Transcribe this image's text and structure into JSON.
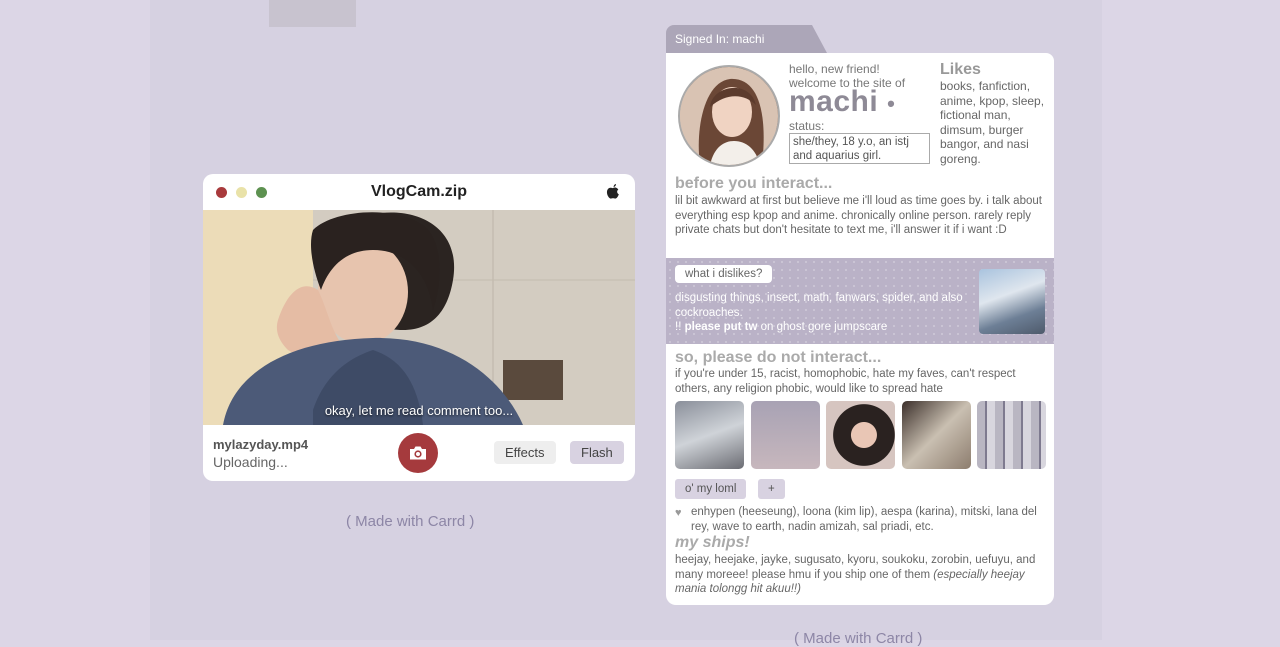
{
  "vlogcam": {
    "title": "VlogCam.zip",
    "caption": "okay, let me read comment too...",
    "file_name": "mylazyday.mp4",
    "file_status": "Uploading...",
    "effects_label": "Effects",
    "flash_label": "Flash",
    "icons": [
      "apple-icon",
      "camera-icon"
    ],
    "traffic_colors": [
      "#a83a3c",
      "#e9e2a8",
      "#5d9150"
    ]
  },
  "footer": {
    "made_with": "( Made with Carrd )"
  },
  "profile": {
    "signed_in": "Signed In: machi",
    "hello_line1": "hello, new friend!",
    "hello_line2": "welcome to the site of",
    "name": "machi",
    "status_label": "status:",
    "status_value": "she/they, 18 y.o, an istj and aquarius girl.",
    "likes_title": "Likes",
    "likes_text": "books, fanfiction, anime, kpop, sleep, fictional man, dimsum, burger bangor, and nasi goreng.",
    "before_title": "before you interact...",
    "before_text": "lil bit awkward at first but believe me i'll loud as time goes by. i talk about everything esp kpop and anime. chronically online person. rarely reply private chats but don't hesitate to text me, i'll answer it if i want :D",
    "dislikes_label": "what i dislikes?",
    "dislikes_text": "disgusting things, insect, math, fanwars, spider, and also cockroaches.",
    "dislikes_note_prefix": "!! ",
    "dislikes_note_bold": "please put tw",
    "dislikes_note_rest": " on ghost gore jumpscare",
    "dni_title": "so, please do not interact...",
    "dni_text": "if you're under 15, racist, homophobic, hate my faves, can't respect others, any religion phobic, would like to spread hate",
    "tab_loml": "o' my loml",
    "tab_plus": "+",
    "favorites_text": "enhypen (heeseung), loona (kim lip), aespa (karina), mitski, lana del rey, wave to earth, nadin amizah, sal priadi, etc.",
    "ships_title": "my ships!",
    "ships_text": "heejay, heejake, jayke, sugusato, kyoru, soukoku, zorobin, uefuyu, and many moreee! please hmu if you ship one of them ",
    "ships_italic": "(especially heejay mania tolongg hit akuu!!)",
    "accent_color": "#bab2c7"
  }
}
